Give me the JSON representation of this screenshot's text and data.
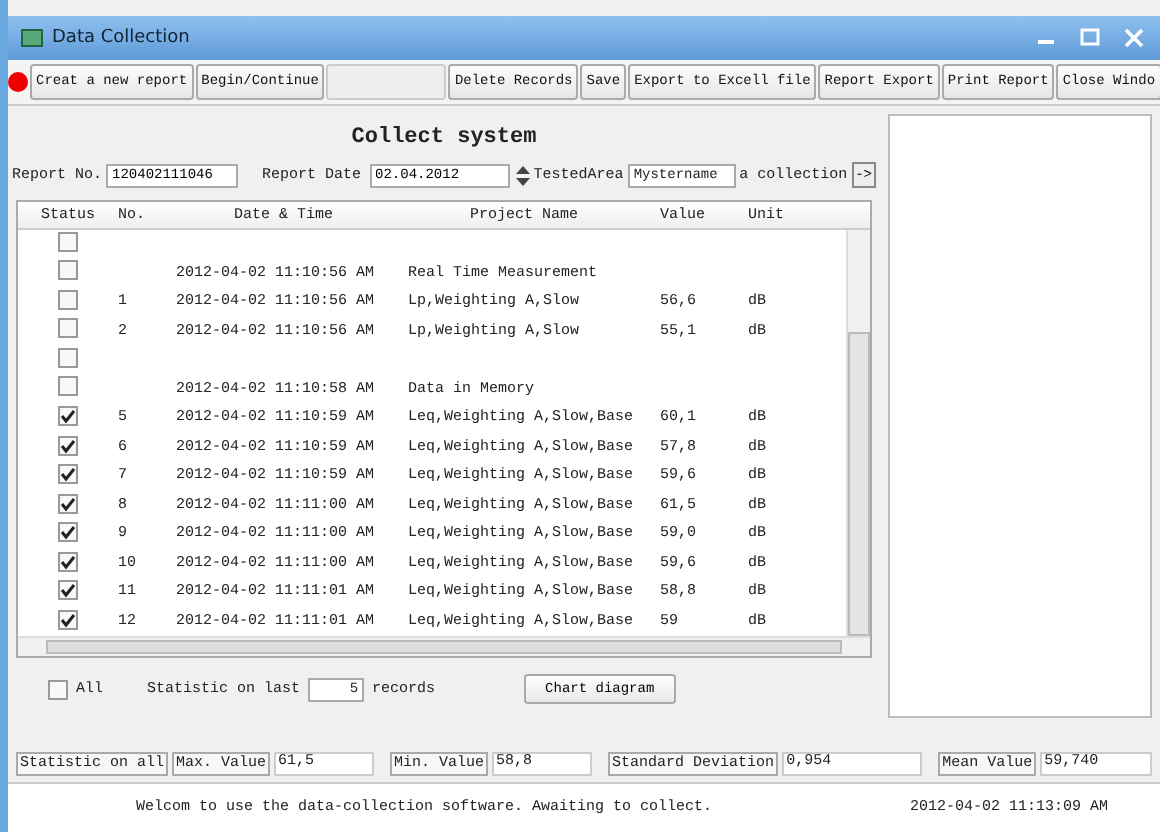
{
  "window": {
    "title": "Data Collection"
  },
  "toolbar": [
    {
      "label": "Creat a new report",
      "disabled": false
    },
    {
      "label": "Begin/Continue",
      "disabled": false
    },
    {
      "disabled": true
    },
    {
      "label": "Delete Records",
      "disabled": false
    },
    {
      "label": "Save",
      "disabled": false
    },
    {
      "label": "Export to Excell file",
      "disabled": false
    },
    {
      "label": "Report Export",
      "disabled": false
    },
    {
      "label": "Print Report",
      "disabled": false
    },
    {
      "label": "Close Windo",
      "disabled": false
    }
  ],
  "heading": "Collect system",
  "form": {
    "report_no_label": "Report No.",
    "report_no": "120402111046",
    "report_date_label": "Report Date",
    "report_date": "02.04.2012",
    "tested_area_label": "TestedArea",
    "tested_area": "Mystername",
    "collection_label": "a collection",
    "collection_button": "->"
  },
  "table": {
    "columns": [
      "Status",
      "No.",
      "Date & Time",
      "Project Name",
      "Value",
      "Unit"
    ],
    "rows": [
      {
        "checked": false
      },
      {
        "checked": false,
        "datetime": "2012-04-02 11:10:56 AM",
        "project": "Real Time Measurement"
      },
      {
        "checked": false,
        "no": "1",
        "datetime": "2012-04-02 11:10:56 AM",
        "project": "Lp,Weighting A,Slow",
        "value": "56,6",
        "unit": "dB"
      },
      {
        "checked": false,
        "no": "2",
        "datetime": "2012-04-02 11:10:56 AM",
        "project": "Lp,Weighting A,Slow",
        "value": "55,1",
        "unit": "dB"
      },
      {
        "checked": false
      },
      {
        "checked": false,
        "datetime": "2012-04-02 11:10:58 AM",
        "project": "Data in Memory"
      },
      {
        "checked": true,
        "no": "5",
        "datetime": "2012-04-02 11:10:59 AM",
        "project": "Leq,Weighting A,Slow,Base",
        "value": "60,1",
        "unit": "dB"
      },
      {
        "checked": true,
        "no": "6",
        "datetime": "2012-04-02 11:10:59 AM",
        "project": "Leq,Weighting A,Slow,Base",
        "value": "57,8",
        "unit": "dB"
      },
      {
        "checked": true,
        "no": "7",
        "datetime": "2012-04-02 11:10:59 AM",
        "project": "Leq,Weighting A,Slow,Base",
        "value": "59,6",
        "unit": "dB"
      },
      {
        "checked": true,
        "no": "8",
        "datetime": "2012-04-02 11:11:00 AM",
        "project": "Leq,Weighting A,Slow,Base",
        "value": "61,5",
        "unit": "dB"
      },
      {
        "checked": true,
        "no": "9",
        "datetime": "2012-04-02 11:11:00 AM",
        "project": "Leq,Weighting A,Slow,Base",
        "value": "59,0",
        "unit": "dB"
      },
      {
        "checked": true,
        "no": "10",
        "datetime": "2012-04-02 11:11:00 AM",
        "project": "Leq,Weighting A,Slow,Base",
        "value": "59,6",
        "unit": "dB"
      },
      {
        "checked": true,
        "no": "11",
        "datetime": "2012-04-02 11:11:01 AM",
        "project": "Leq,Weighting A,Slow,Base",
        "value": "58,8",
        "unit": "dB"
      },
      {
        "checked": true,
        "no": "12",
        "datetime": "2012-04-02 11:11:01 AM",
        "project": "Leq,Weighting A,Slow,Base",
        "value": "59",
        "unit": "dB"
      }
    ]
  },
  "options": {
    "all_label": "All",
    "all_checked": false,
    "stat_last_label": "Statistic on last",
    "stat_last_value": "5",
    "records_label": "records",
    "chart_button": "Chart diagram"
  },
  "stats": {
    "label": "Statistic on all",
    "max_label": "Max. Value",
    "max": "61,5",
    "min_label": "Min. Value",
    "min": "58,8",
    "std_label": "Standard Deviation",
    "std": "0,954",
    "mean_label": "Mean Value",
    "mean": "59,740"
  },
  "status_bar": {
    "message": "Welcom to use the data-collection software. Awaiting to collect.",
    "time": "2012-04-02 11:13:09 AM"
  }
}
